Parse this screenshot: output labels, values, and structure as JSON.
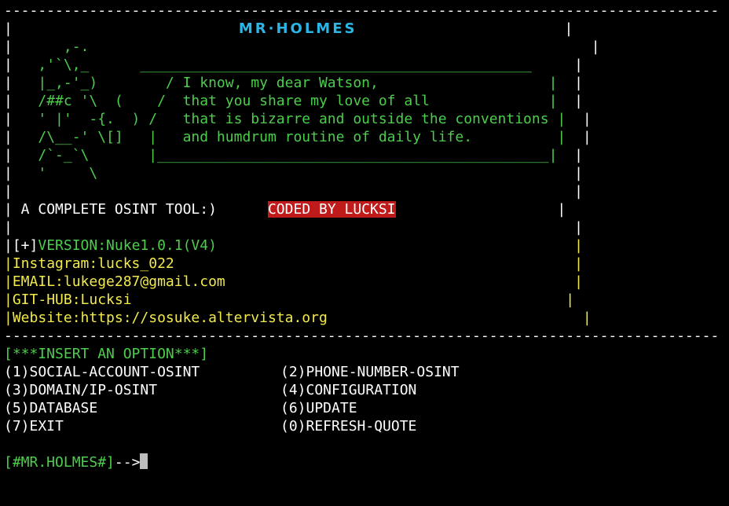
{
  "terminal": {
    "top_border": "------------------------------------------------------------------------------------",
    "bottom_border": "------------------------------------------------------------------------------------",
    "title": "MR·HOLMES",
    "ascii_art": [
      "|   ,'`\\,_      _________________________________________________  |",
      "|   |_,-'_)        / I know, my dear Watson,                       |  |",
      "|   /##c '\\  (    /  that you share my love of all                 |  |",
      "|   ' |'  -{.  ) /   that is bizarre and outside the conventions   |  |",
      "|   /\\__-' \\[]   |   and humdrum routine of daily life.            |  |",
      "|   /`-_`\\       |_________________________________________________|  |",
      "|   '     \\                                                           |",
      "|                                                                     |"
    ],
    "art_top": "|      ,-.                                                          |",
    "tagline": " A COMPLETE OSINT TOOL:)",
    "coded_by": "CODED BY LUCKSI",
    "info": {
      "version_prefix": "[+]",
      "version": "VERSION:Nuke1.0.1(V4)",
      "instagram": "Instagram:lucks_022",
      "email": "EMAIL:lukege287@gmail.com",
      "github": "GIT-HUB:Lucksi",
      "website": "Website:https://sosuke.altervista.org"
    },
    "menu_header": "[***INSERT AN OPTION***]",
    "options": [
      "(1)SOCIAL-ACCOUNT-OSINT",
      "(2)PHONE-NUMBER-OSINT",
      "(3)DOMAIN/IP-OSINT",
      "(4)CONFIGURATION",
      "(5)DATABASE",
      "(6)UPDATE",
      "(7)EXIT",
      "(0)REFRESH-QUOTE"
    ],
    "prompt": "[#MR.HOLMES#]",
    "prompt_arrow": "-->"
  },
  "colors": {
    "background": "#000000",
    "title": "#2bb7e6",
    "quote_green": "#4ccd4c",
    "info_yellow": "#f2ea4a",
    "coded_bg": "#c01b1b",
    "text_white": "#ffffff"
  }
}
